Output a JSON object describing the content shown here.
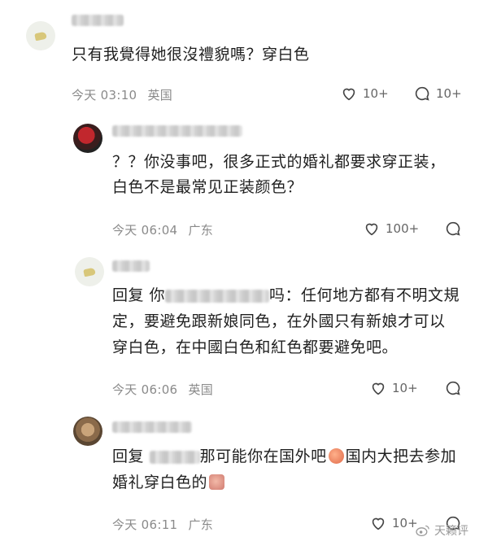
{
  "comments": [
    {
      "text": "只有我覺得她很沒禮貌嗎？穿白色",
      "time": "今天 03:10",
      "location": "英国",
      "likes": "10+",
      "replies": "10+"
    },
    {
      "text_line1": "？？你没事吧，很多正式的婚礼都要求穿正装，",
      "text_line2": "白色不是最常见正装颜色？",
      "time": "今天 06:04",
      "location": "广东",
      "likes": "100+"
    },
    {
      "reply_prefix": "回复 你",
      "text_suffix": "吗：任何地方都有不明文規",
      "text_line2": "定，要避免跟新娘同色，在外國只有新娘才可以",
      "text_line3": "穿白色，在中國白色和紅色都要避免吧。",
      "time": "今天 06:06",
      "location": "英国",
      "likes": "10+"
    },
    {
      "reply_prefix": "回复",
      "text_part1": "那可能你在国外吧",
      "text_part2": "国内大把去参加",
      "text_line2": "婚礼穿白色的",
      "time": "今天 06:11",
      "location": "广东",
      "likes": "10+"
    }
  ],
  "watermark": "天籁评"
}
